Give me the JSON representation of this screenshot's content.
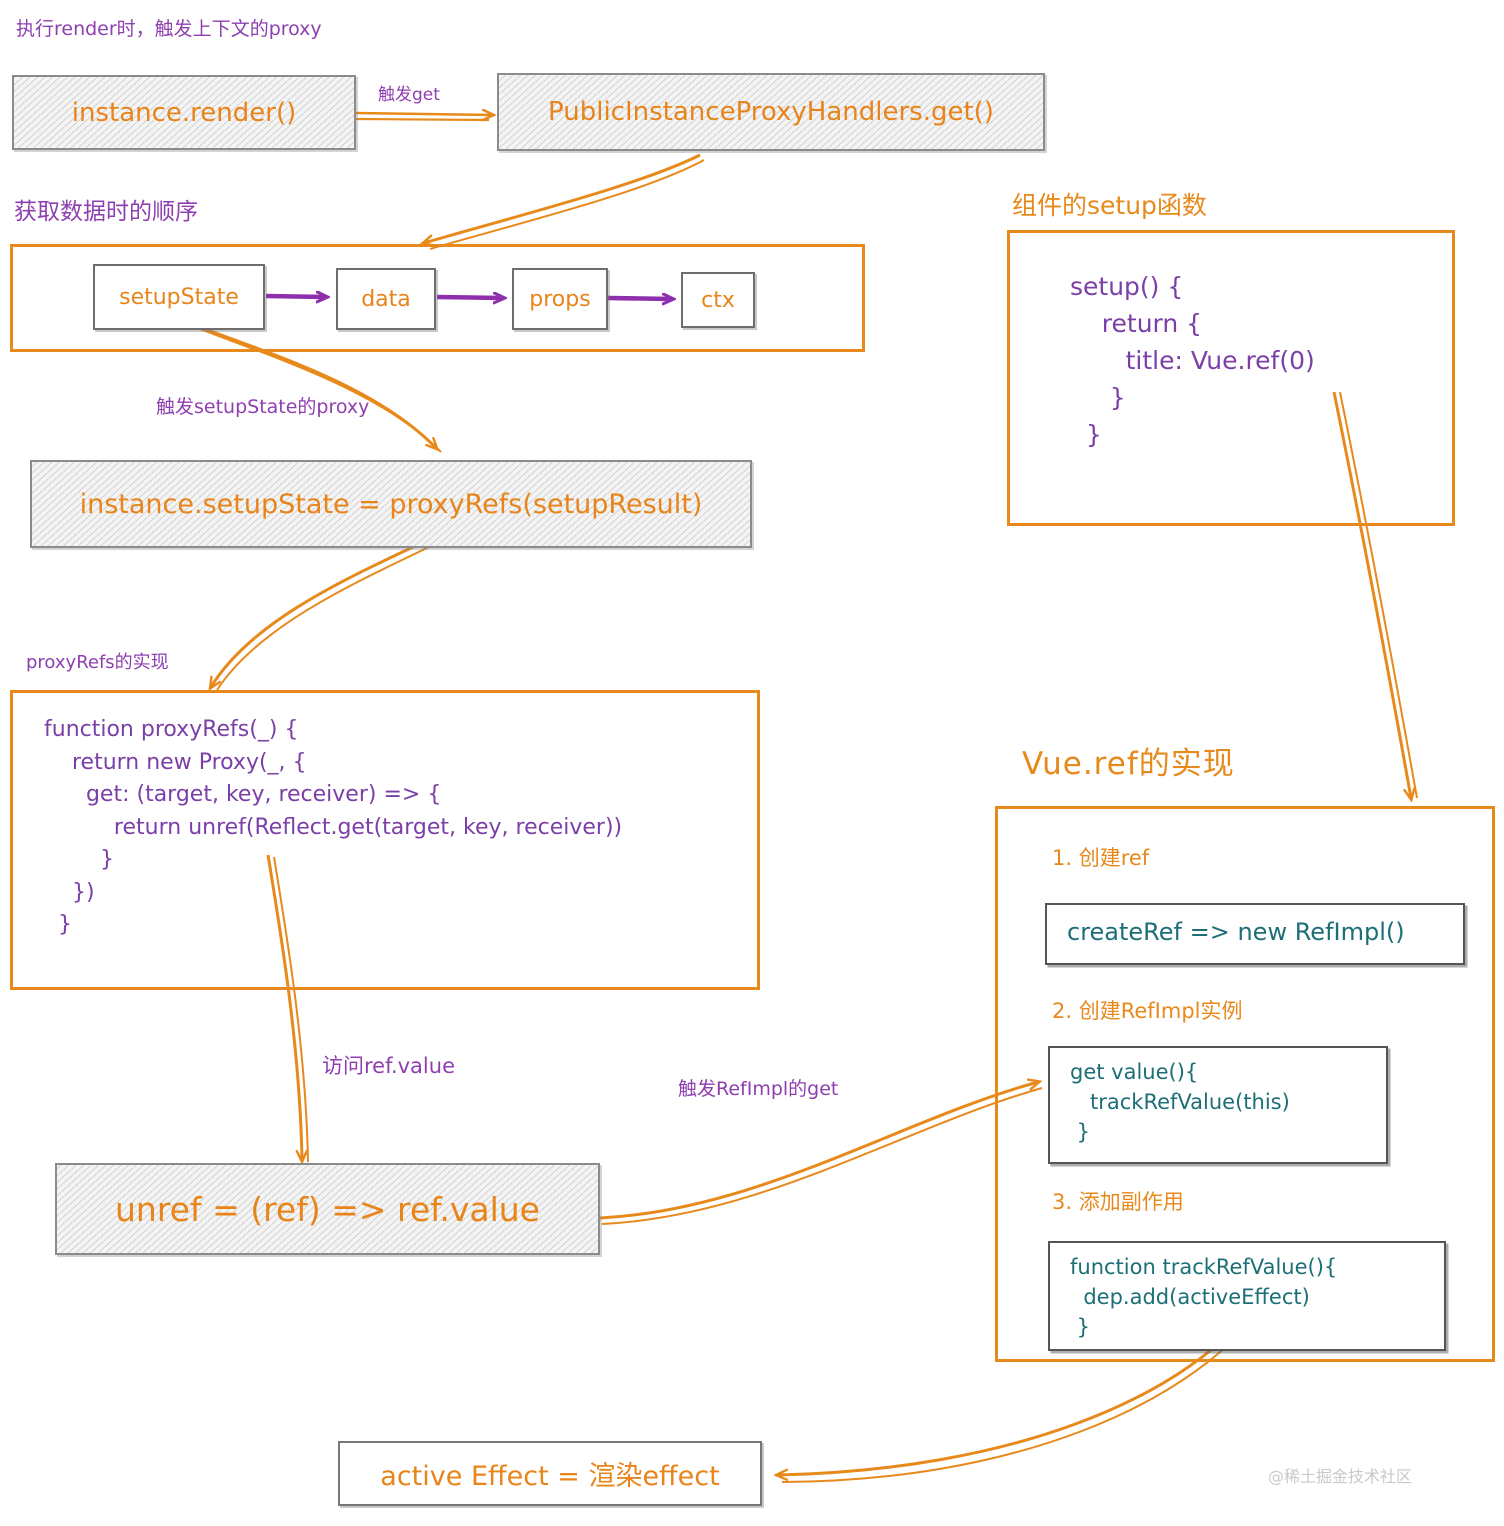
{
  "diagram": {
    "title_note_top": "执行render时，触发上下文的proxy",
    "watermark": "@稀土掘金技术社区"
  },
  "nodes": {
    "instance_render": "instance.render()",
    "proxy_handlers_get": "PublicInstanceProxyHandlers.get()",
    "setup_state_assign": "instance.setupState = proxyRefs(setupResult)",
    "unref_box": "unref = (ref) =>  ref.value",
    "active_effect_box": "active Effect = 渲染effect"
  },
  "order_panel": {
    "caption": "获取数据时的顺序",
    "items": [
      "setupState",
      "data",
      "props",
      "ctx"
    ]
  },
  "setup_panel": {
    "caption": "组件的setup函数",
    "code": "setup() {\n    return {\n       title: Vue.ref(0)\n     }\n  }"
  },
  "proxyrefs_panel": {
    "caption": "proxyRefs的实现",
    "code": "function proxyRefs(_) {\n    return new Proxy(_, {\n      get: (target, key, receiver) => {\n          return unref(Reflect.get(target, key, receiver))\n        }\n    })\n  }"
  },
  "vueref_panel": {
    "caption": "Vue.ref的实现",
    "steps": [
      {
        "label": "1. 创建ref",
        "code": "createRef => new RefImpl()"
      },
      {
        "label": "2. 创建RefImpl实例",
        "code": "get value(){\n   trackRefValue(this)\n }"
      },
      {
        "label": "3. 添加副作用",
        "code": "function trackRefValue(){\n  dep.add(activeEffect)\n }"
      }
    ]
  },
  "arrow_labels": {
    "trigger_get": "触发get",
    "trigger_setupstate_proxy": "触发setupState的proxy",
    "access_ref_value": "访问ref.value",
    "trigger_refimpl_get": "触发RefImpl的get"
  },
  "colors": {
    "orange": "#e8891b",
    "purple": "#8e3fb0",
    "teal": "#1d6f77",
    "blue": "#4b3fcf",
    "grey_border": "#8b8b8b"
  }
}
